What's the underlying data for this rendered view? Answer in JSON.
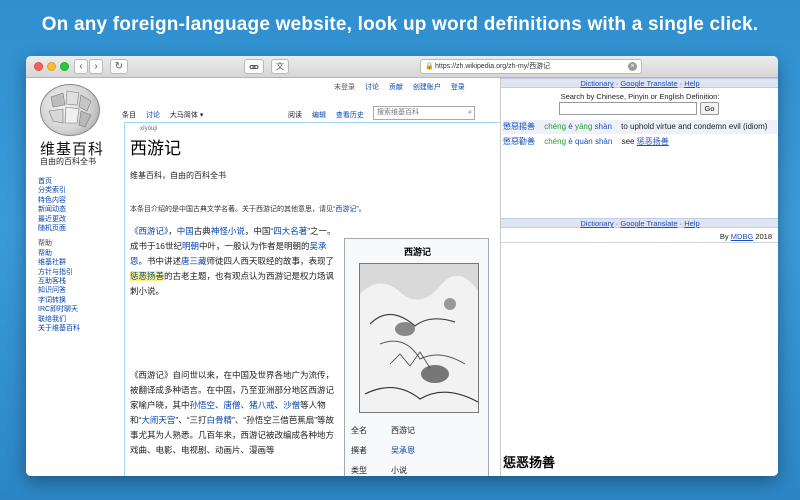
{
  "headline": "On any foreign-language website, look up word definitions with a single click.",
  "toolbar": {
    "back": "‹",
    "forward": "›",
    "reload": "↻",
    "link_icon": "link-icon",
    "dict_icon": "文",
    "url": "https://zh.wikipedia.org/zh-my/西游记"
  },
  "wiki": {
    "logo_title": "维基百科",
    "logo_subtitle": "自由的百科全书",
    "personal": [
      "未登录",
      "讨论",
      "贡献",
      "创建账户",
      "登录"
    ],
    "tabs": [
      "条目",
      "讨论",
      "大马简体 ▾"
    ],
    "views": [
      "阅读",
      "编辑",
      "查看历史"
    ],
    "search_placeholder": "搜索维基百科",
    "sidebar": {
      "group1": [
        "首页",
        "分类索引",
        "特色内容",
        "新闻动态",
        "最近更改",
        "随机页面"
      ],
      "help_head": "帮助",
      "help": [
        "帮助",
        "维基社群",
        "方针与指引",
        "互助客栈",
        "知识问答",
        "字词转换",
        "IRC即时聊天",
        "联络我们",
        "关于维基百科"
      ]
    },
    "title_pinyin": "xīyóujì",
    "title": "西游记",
    "subtitle": "维基百科，自由的百科全书",
    "note_prefix": "本条目介绍的是中国古典文学名著。关于西游记的其他意思，请见",
    "note_link": "“西游记”",
    "note_suffix": "。",
    "p1": {
      "a": "《西游记》",
      "b": "，",
      "c": "中国",
      "d": "古典",
      "e": "神怪",
      "f": "小说",
      "g": "，中国“",
      "h": "四大名著",
      "i": "”之一。成书于16世纪",
      "j": "明朝",
      "k": "中叶，一般认为作者是明朝的",
      "l": "吴承恩",
      "m": "。书中讲述",
      "n": "唐三藏",
      "o": "师徒四人西天取经的故事，表现了",
      "hl": "惩恶扬善",
      "p": "的古老主题，也有观点认为西游记是权力场讽刺小说。"
    },
    "p2": {
      "a": "《西游记》自问世以来，在中国及世界各地广为流传，被翻译成多种语言。在中国，乃至亚洲部分地区西游记家喻户晓，其中",
      "b": "孙悟空",
      "c": "、",
      "d": "唐僧",
      "e": "、",
      "f": "猪八戒",
      "g": "、",
      "h": "沙僧",
      "i": "等人物和“",
      "j": "大闹天宫",
      "k": "”、“三打",
      "l": "白骨精",
      "m": "”、“孙悟空三借芭蕉扇”等故事尤其为人熟悉。几百年来，西游记被改编成各种地方戏曲、电影、电视剧、动画片、漫画等"
    },
    "infobox": {
      "title": "西游记",
      "rows": [
        {
          "k": "全名",
          "v": "西游记",
          "link": false
        },
        {
          "k": "撰者",
          "v": "吴承恩",
          "link": true
        },
        {
          "k": "类型",
          "v": "小说",
          "link": false
        }
      ]
    }
  },
  "dict": {
    "bar_dictionary": "Dictionary",
    "bar_sep1": " · ",
    "bar_google": "Google Translate",
    "bar_sep2": " · ",
    "bar_help": "Help",
    "prompt": "Search by Chinese, Pinyin or English Definition:",
    "go": "Go",
    "entries": [
      {
        "zh": "懲惡揚善",
        "py": [
          "chéng",
          "è",
          "yáng",
          "shàn"
        ],
        "gloss": "to uphold virtue and condemn evil (idiom)"
      },
      {
        "zh": "懲惡勸善",
        "py": [
          "chéng",
          "è",
          "quàn",
          "shàn"
        ],
        "see": "see",
        "see_link": "惩恶扬善"
      }
    ],
    "credit_by": "By",
    "credit_link": "MDBG",
    "credit_year": "2018",
    "bigword": "惩恶扬善"
  },
  "colors": {
    "background": "#3a9bd9",
    "link": "#0645ad",
    "highlight": "#fff27a",
    "tone1": "#e07020",
    "tone4": "#1a4fc0",
    "tone2": "#2a9a2a"
  }
}
